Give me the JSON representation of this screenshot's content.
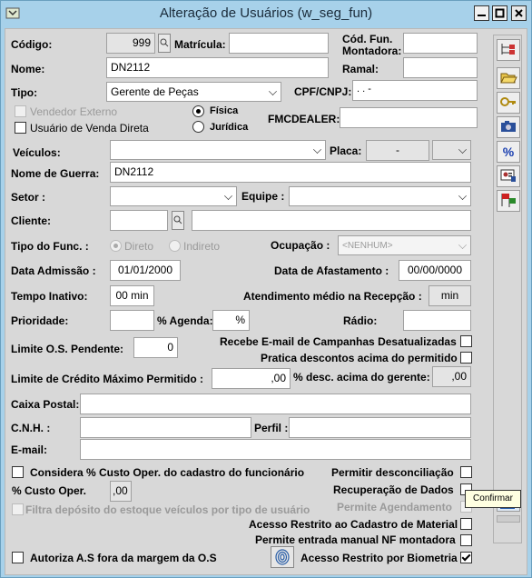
{
  "window": {
    "title": "Alteração de Usuários (w_seg_fun)",
    "minimize": "▬",
    "maximize": "◻",
    "close": "✕"
  },
  "form": {
    "codigo": {
      "label": "Código:",
      "value": "999"
    },
    "matricula": {
      "label": "Matrícula:",
      "value": ""
    },
    "cod_fun_montadora": {
      "label": "Cód. Fun. Montadora:",
      "value": ""
    },
    "nome": {
      "label": "Nome:",
      "value": "DN2112"
    },
    "ramal": {
      "label": "Ramal:",
      "value": ""
    },
    "tipo": {
      "label": "Tipo:",
      "value": "Gerente de Peças"
    },
    "cpf_cnpj": {
      "label": "CPF/CNPJ:",
      "value": " .   .   -"
    },
    "vendedor_externo": {
      "label": "Vendedor Externo",
      "checked": false
    },
    "usuario_venda_direta": {
      "label": "Usuário de Venda Direta",
      "checked": false
    },
    "pessoa": {
      "fisica": "Física",
      "juridica": "Jurídica",
      "selected": "fisica"
    },
    "fmcdealer": {
      "label": "FMCDEALER:",
      "value": ""
    },
    "veiculos": {
      "label": "Veículos:",
      "value": ""
    },
    "placa": {
      "label": "Placa:",
      "value": "-"
    },
    "nome_guerra": {
      "label": "Nome de Guerra:",
      "value": "DN2112"
    },
    "setor": {
      "label": "Setor :",
      "value": ""
    },
    "equipe": {
      "label": "Equipe :",
      "value": ""
    },
    "cliente": {
      "label": "Cliente:",
      "value": "",
      "name": ""
    },
    "tipo_func": {
      "label": "Tipo do Func. :",
      "direto": "Direto",
      "indireto": "Indireto",
      "selected": "direto"
    },
    "ocupacao": {
      "label": "Ocupação :",
      "value": "<NENHUM>"
    },
    "data_admissao": {
      "label": "Data Admissão :",
      "value": "01/01/2000"
    },
    "data_afastamento": {
      "label": "Data de Afastamento :",
      "value": "00/00/0000"
    },
    "tempo_inativo": {
      "label": "Tempo Inativo:",
      "value": "00 min"
    },
    "atendimento_medio": {
      "label": "Atendimento médio na Recepção :",
      "value": "min"
    },
    "prioridade": {
      "label": "Prioridade:",
      "value": ""
    },
    "agenda": {
      "label": "% Agenda:",
      "value": "%"
    },
    "radio": {
      "label": "Rádio:",
      "value": ""
    },
    "limite_os": {
      "label": "Limite O.S. Pendente:",
      "value": "0"
    },
    "recebe_email": {
      "label": "Recebe E-mail de Campanhas Desatualizadas",
      "checked": false
    },
    "pratica_descontos": {
      "label": "Pratica descontos acima do permitido",
      "checked": false
    },
    "limite_credito": {
      "label": "Limite de Crédito Máximo Permitido :",
      "value": ",00"
    },
    "desc_acima_gerente": {
      "label": "% desc. acima do gerente:",
      "value": ",00"
    },
    "caixa_postal": {
      "label": "Caixa Postal:",
      "value": ""
    },
    "cnh": {
      "label": "C.N.H. :",
      "value": ""
    },
    "perfil": {
      "label": "Perfil :",
      "value": ""
    },
    "email": {
      "label": "E-mail:",
      "value": ""
    },
    "considera_custo": {
      "label": "Considera % Custo Oper. do cadastro do funcionário",
      "checked": false
    },
    "permitir_desconciliacao": {
      "label": "Permitir desconciliação",
      "checked": false
    },
    "custo_oper": {
      "label": "% Custo Oper.",
      "value": ",00"
    },
    "recuperacao_dados": {
      "label": "Recuperação de Dados",
      "checked": false
    },
    "filtra_deposito": {
      "label": "Filtra depósito do estoque veículos por tipo de usuário",
      "checked": false
    },
    "permite_agendamento": {
      "label": "Permite Agendamento",
      "checked": false
    },
    "acesso_restrito_material": {
      "label": "Acesso Restrito ao Cadastro de Material",
      "checked": false
    },
    "permite_nf_montadora": {
      "label": "Permite entrada manual NF montadora",
      "checked": false
    },
    "autoriza_as": {
      "label": "Autoriza A.S fora da margem da O.S",
      "checked": false
    },
    "acesso_biometria": {
      "label": "Acesso Restrito por Biometria",
      "checked": true
    }
  },
  "toolbar": {
    "items": [
      "tree-icon",
      "open-folder-icon",
      "key-icon",
      "camera-icon",
      "percent-icon",
      "id-card-icon",
      "flags-icon"
    ],
    "percent_glyph": "%",
    "confirm_tooltip": "Confirmar"
  }
}
